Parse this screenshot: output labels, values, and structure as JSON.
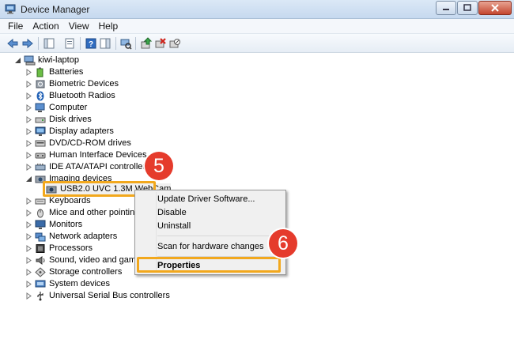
{
  "window": {
    "title": "Device Manager"
  },
  "menu": {
    "items": [
      "File",
      "Action",
      "View",
      "Help"
    ]
  },
  "toolbar": {
    "icons": [
      "back-arrow-icon",
      "forward-arrow-icon",
      "show-hide-console-tree-icon",
      "properties-icon",
      "help-icon",
      "scan-hardware-icon",
      "update-driver-icon",
      "uninstall-icon",
      "disable-icon"
    ]
  },
  "tree": {
    "root": "kiwi-laptop",
    "categories": [
      "Batteries",
      "Biometric Devices",
      "Bluetooth Radios",
      "Computer",
      "Disk drives",
      "Display adapters",
      "DVD/CD-ROM drives",
      "Human Interface Devices",
      "IDE ATA/ATAPI controllers",
      "Imaging devices",
      "Keyboards",
      "Mice and other pointing d",
      "Monitors",
      "Network adapters",
      "Processors",
      "Sound, video and game co",
      "Storage controllers",
      "System devices",
      "Universal Serial Bus controllers"
    ],
    "imaging_child": "USB2.0 UVC 1.3M WebCam"
  },
  "context_menu": {
    "items": [
      "Update Driver Software...",
      "Disable",
      "Uninstall",
      "Scan for hardware changes",
      "Properties"
    ]
  },
  "annotations": {
    "step_a": "5",
    "step_b": "6"
  },
  "colors": {
    "highlight": "#f2a81d",
    "badge": "#e53b2c"
  }
}
